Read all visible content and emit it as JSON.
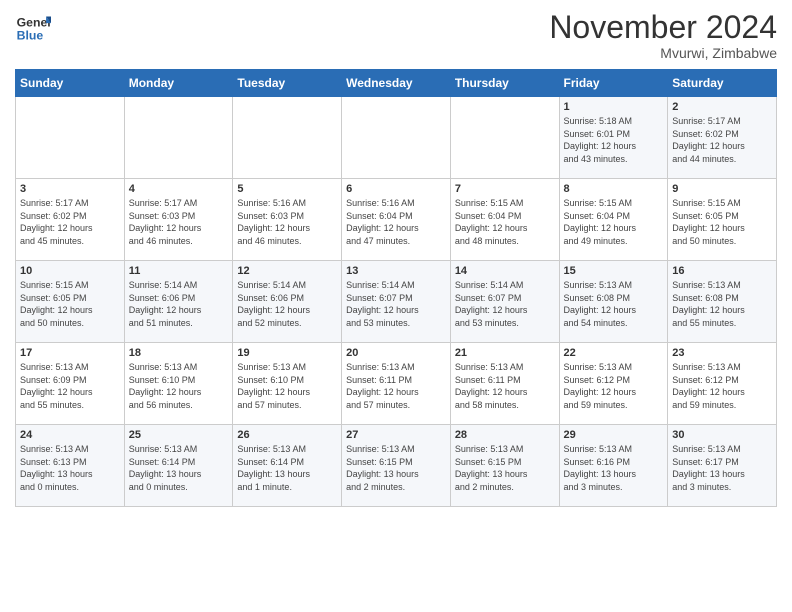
{
  "header": {
    "logo_line1": "General",
    "logo_line2": "Blue",
    "month": "November 2024",
    "location": "Mvurwi, Zimbabwe"
  },
  "days_of_week": [
    "Sunday",
    "Monday",
    "Tuesday",
    "Wednesday",
    "Thursday",
    "Friday",
    "Saturday"
  ],
  "weeks": [
    [
      {
        "day": "",
        "info": ""
      },
      {
        "day": "",
        "info": ""
      },
      {
        "day": "",
        "info": ""
      },
      {
        "day": "",
        "info": ""
      },
      {
        "day": "",
        "info": ""
      },
      {
        "day": "1",
        "info": "Sunrise: 5:18 AM\nSunset: 6:01 PM\nDaylight: 12 hours\nand 43 minutes."
      },
      {
        "day": "2",
        "info": "Sunrise: 5:17 AM\nSunset: 6:02 PM\nDaylight: 12 hours\nand 44 minutes."
      }
    ],
    [
      {
        "day": "3",
        "info": "Sunrise: 5:17 AM\nSunset: 6:02 PM\nDaylight: 12 hours\nand 45 minutes."
      },
      {
        "day": "4",
        "info": "Sunrise: 5:17 AM\nSunset: 6:03 PM\nDaylight: 12 hours\nand 46 minutes."
      },
      {
        "day": "5",
        "info": "Sunrise: 5:16 AM\nSunset: 6:03 PM\nDaylight: 12 hours\nand 46 minutes."
      },
      {
        "day": "6",
        "info": "Sunrise: 5:16 AM\nSunset: 6:04 PM\nDaylight: 12 hours\nand 47 minutes."
      },
      {
        "day": "7",
        "info": "Sunrise: 5:15 AM\nSunset: 6:04 PM\nDaylight: 12 hours\nand 48 minutes."
      },
      {
        "day": "8",
        "info": "Sunrise: 5:15 AM\nSunset: 6:04 PM\nDaylight: 12 hours\nand 49 minutes."
      },
      {
        "day": "9",
        "info": "Sunrise: 5:15 AM\nSunset: 6:05 PM\nDaylight: 12 hours\nand 50 minutes."
      }
    ],
    [
      {
        "day": "10",
        "info": "Sunrise: 5:15 AM\nSunset: 6:05 PM\nDaylight: 12 hours\nand 50 minutes."
      },
      {
        "day": "11",
        "info": "Sunrise: 5:14 AM\nSunset: 6:06 PM\nDaylight: 12 hours\nand 51 minutes."
      },
      {
        "day": "12",
        "info": "Sunrise: 5:14 AM\nSunset: 6:06 PM\nDaylight: 12 hours\nand 52 minutes."
      },
      {
        "day": "13",
        "info": "Sunrise: 5:14 AM\nSunset: 6:07 PM\nDaylight: 12 hours\nand 53 minutes."
      },
      {
        "day": "14",
        "info": "Sunrise: 5:14 AM\nSunset: 6:07 PM\nDaylight: 12 hours\nand 53 minutes."
      },
      {
        "day": "15",
        "info": "Sunrise: 5:13 AM\nSunset: 6:08 PM\nDaylight: 12 hours\nand 54 minutes."
      },
      {
        "day": "16",
        "info": "Sunrise: 5:13 AM\nSunset: 6:08 PM\nDaylight: 12 hours\nand 55 minutes."
      }
    ],
    [
      {
        "day": "17",
        "info": "Sunrise: 5:13 AM\nSunset: 6:09 PM\nDaylight: 12 hours\nand 55 minutes."
      },
      {
        "day": "18",
        "info": "Sunrise: 5:13 AM\nSunset: 6:10 PM\nDaylight: 12 hours\nand 56 minutes."
      },
      {
        "day": "19",
        "info": "Sunrise: 5:13 AM\nSunset: 6:10 PM\nDaylight: 12 hours\nand 57 minutes."
      },
      {
        "day": "20",
        "info": "Sunrise: 5:13 AM\nSunset: 6:11 PM\nDaylight: 12 hours\nand 57 minutes."
      },
      {
        "day": "21",
        "info": "Sunrise: 5:13 AM\nSunset: 6:11 PM\nDaylight: 12 hours\nand 58 minutes."
      },
      {
        "day": "22",
        "info": "Sunrise: 5:13 AM\nSunset: 6:12 PM\nDaylight: 12 hours\nand 59 minutes."
      },
      {
        "day": "23",
        "info": "Sunrise: 5:13 AM\nSunset: 6:12 PM\nDaylight: 12 hours\nand 59 minutes."
      }
    ],
    [
      {
        "day": "24",
        "info": "Sunrise: 5:13 AM\nSunset: 6:13 PM\nDaylight: 13 hours\nand 0 minutes."
      },
      {
        "day": "25",
        "info": "Sunrise: 5:13 AM\nSunset: 6:14 PM\nDaylight: 13 hours\nand 0 minutes."
      },
      {
        "day": "26",
        "info": "Sunrise: 5:13 AM\nSunset: 6:14 PM\nDaylight: 13 hours\nand 1 minute."
      },
      {
        "day": "27",
        "info": "Sunrise: 5:13 AM\nSunset: 6:15 PM\nDaylight: 13 hours\nand 2 minutes."
      },
      {
        "day": "28",
        "info": "Sunrise: 5:13 AM\nSunset: 6:15 PM\nDaylight: 13 hours\nand 2 minutes."
      },
      {
        "day": "29",
        "info": "Sunrise: 5:13 AM\nSunset: 6:16 PM\nDaylight: 13 hours\nand 3 minutes."
      },
      {
        "day": "30",
        "info": "Sunrise: 5:13 AM\nSunset: 6:17 PM\nDaylight: 13 hours\nand 3 minutes."
      }
    ]
  ]
}
